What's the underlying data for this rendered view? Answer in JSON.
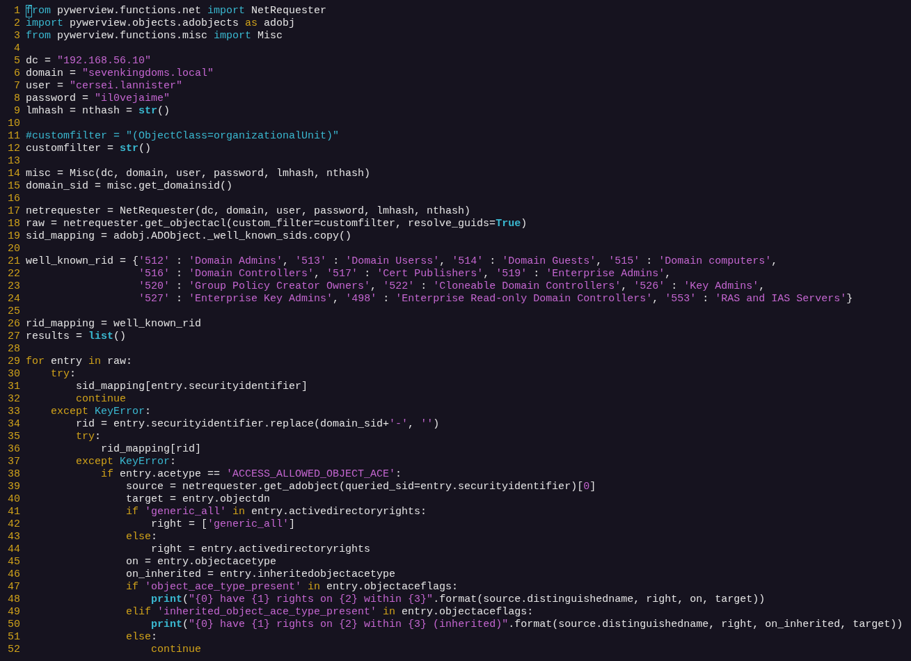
{
  "editor": {
    "lines": [
      {
        "number": "1",
        "cursor": true,
        "tokens": [
          {
            "kind": "import",
            "text": "from"
          },
          {
            "kind": "text",
            "text": " pywerview.functions.net "
          },
          {
            "kind": "import",
            "text": "import"
          },
          {
            "kind": "text",
            "text": " NetRequester"
          }
        ]
      },
      {
        "number": "2",
        "cursor": false,
        "tokens": [
          {
            "kind": "import",
            "text": "import"
          },
          {
            "kind": "text",
            "text": " pywerview.objects.adobjects "
          },
          {
            "kind": "keyword",
            "text": "as"
          },
          {
            "kind": "text",
            "text": " adobj"
          }
        ]
      },
      {
        "number": "3",
        "cursor": false,
        "tokens": [
          {
            "kind": "import",
            "text": "from"
          },
          {
            "kind": "text",
            "text": " pywerview.functions.misc "
          },
          {
            "kind": "import",
            "text": "import"
          },
          {
            "kind": "text",
            "text": " Misc"
          }
        ]
      },
      {
        "number": "4",
        "cursor": false
      },
      {
        "number": "5",
        "cursor": false,
        "tokens": [
          {
            "kind": "text",
            "text": "dc = "
          },
          {
            "kind": "string",
            "text": "\"192.168.56.10\""
          }
        ]
      },
      {
        "number": "6",
        "cursor": false,
        "tokens": [
          {
            "kind": "text",
            "text": "domain = "
          },
          {
            "kind": "string",
            "text": "\"sevenkingdoms.local\""
          }
        ]
      },
      {
        "number": "7",
        "cursor": false,
        "tokens": [
          {
            "kind": "text",
            "text": "user = "
          },
          {
            "kind": "string",
            "text": "\"cersei.lannister\""
          }
        ]
      },
      {
        "number": "8",
        "cursor": false,
        "tokens": [
          {
            "kind": "text",
            "text": "password = "
          },
          {
            "kind": "string",
            "text": "\"il0vejaime\""
          }
        ]
      },
      {
        "number": "9",
        "cursor": false,
        "tokens": [
          {
            "kind": "text",
            "text": "lmhash = nthash = "
          },
          {
            "kind": "builtin",
            "text": "str"
          },
          {
            "kind": "text",
            "text": "()"
          }
        ]
      },
      {
        "number": "10",
        "cursor": false
      },
      {
        "number": "11",
        "cursor": false,
        "tokens": [
          {
            "kind": "comment",
            "text": "#customfilter = \"(ObjectClass=organizationalUnit)\""
          }
        ]
      },
      {
        "number": "12",
        "cursor": false,
        "tokens": [
          {
            "kind": "text",
            "text": "customfilter = "
          },
          {
            "kind": "builtin",
            "text": "str"
          },
          {
            "kind": "text",
            "text": "()"
          }
        ]
      },
      {
        "number": "13",
        "cursor": false
      },
      {
        "number": "14",
        "cursor": false,
        "tokens": [
          {
            "kind": "text",
            "text": "misc = Misc(dc, domain, user, password, lmhash, nthash)"
          }
        ]
      },
      {
        "number": "15",
        "cursor": false,
        "tokens": [
          {
            "kind": "text",
            "text": "domain_sid = misc.get_domainsid()"
          }
        ]
      },
      {
        "number": "16",
        "cursor": false
      },
      {
        "number": "17",
        "cursor": false,
        "tokens": [
          {
            "kind": "text",
            "text": "netrequester = NetRequester(dc, domain, user, password, lmhash, nthash)"
          }
        ]
      },
      {
        "number": "18",
        "cursor": false,
        "tokens": [
          {
            "kind": "text",
            "text": "raw = netrequester.get_objectacl(custom_filter=customfilter, resolve_guids="
          },
          {
            "kind": "builtin",
            "text": "True"
          },
          {
            "kind": "text",
            "text": ")"
          }
        ]
      },
      {
        "number": "19",
        "cursor": false,
        "tokens": [
          {
            "kind": "text",
            "text": "sid_mapping = adobj.ADObject._well_known_sids.copy()"
          }
        ]
      },
      {
        "number": "20",
        "cursor": false
      },
      {
        "number": "21",
        "cursor": false,
        "tokens": [
          {
            "kind": "text",
            "text": "well_known_rid = {"
          },
          {
            "kind": "string",
            "text": "'512'"
          },
          {
            "kind": "text",
            "text": " : "
          },
          {
            "kind": "string",
            "text": "'Domain Admins'"
          },
          {
            "kind": "text",
            "text": ", "
          },
          {
            "kind": "string",
            "text": "'513'"
          },
          {
            "kind": "text",
            "text": " : "
          },
          {
            "kind": "string",
            "text": "'Domain Userss'"
          },
          {
            "kind": "text",
            "text": ", "
          },
          {
            "kind": "string",
            "text": "'514'"
          },
          {
            "kind": "text",
            "text": " : "
          },
          {
            "kind": "string",
            "text": "'Domain Guests'"
          },
          {
            "kind": "text",
            "text": ", "
          },
          {
            "kind": "string",
            "text": "'515'"
          },
          {
            "kind": "text",
            "text": " : "
          },
          {
            "kind": "string",
            "text": "'Domain computers'"
          },
          {
            "kind": "text",
            "text": ","
          }
        ]
      },
      {
        "number": "22",
        "cursor": false,
        "tokens": [
          {
            "kind": "string",
            "text": "                  '516'"
          },
          {
            "kind": "text",
            "text": " : "
          },
          {
            "kind": "string",
            "text": "'Domain Controllers'"
          },
          {
            "kind": "text",
            "text": ", "
          },
          {
            "kind": "string",
            "text": "'517'"
          },
          {
            "kind": "text",
            "text": " : "
          },
          {
            "kind": "string",
            "text": "'Cert Publishers'"
          },
          {
            "kind": "text",
            "text": ", "
          },
          {
            "kind": "string",
            "text": "'519'"
          },
          {
            "kind": "text",
            "text": " : "
          },
          {
            "kind": "string",
            "text": "'Enterprise Admins'"
          },
          {
            "kind": "text",
            "text": ","
          }
        ]
      },
      {
        "number": "23",
        "cursor": false,
        "tokens": [
          {
            "kind": "string",
            "text": "                  '520'"
          },
          {
            "kind": "text",
            "text": " : "
          },
          {
            "kind": "string",
            "text": "'Group Policy Creator Owners'"
          },
          {
            "kind": "text",
            "text": ", "
          },
          {
            "kind": "string",
            "text": "'522'"
          },
          {
            "kind": "text",
            "text": " : "
          },
          {
            "kind": "string",
            "text": "'Cloneable Domain Controllers'"
          },
          {
            "kind": "text",
            "text": ", "
          },
          {
            "kind": "string",
            "text": "'526'"
          },
          {
            "kind": "text",
            "text": " : "
          },
          {
            "kind": "string",
            "text": "'Key Admins'"
          },
          {
            "kind": "text",
            "text": ","
          }
        ]
      },
      {
        "number": "24",
        "cursor": false,
        "tokens": [
          {
            "kind": "string",
            "text": "                  '527'"
          },
          {
            "kind": "text",
            "text": " : "
          },
          {
            "kind": "string",
            "text": "'Enterprise Key Admins'"
          },
          {
            "kind": "text",
            "text": ", "
          },
          {
            "kind": "string",
            "text": "'498'"
          },
          {
            "kind": "text",
            "text": " : "
          },
          {
            "kind": "string",
            "text": "'Enterprise Read-only Domain Controllers'"
          },
          {
            "kind": "text",
            "text": ", "
          },
          {
            "kind": "string",
            "text": "'553'"
          },
          {
            "kind": "text",
            "text": " : "
          },
          {
            "kind": "string",
            "text": "'RAS and IAS Servers'"
          },
          {
            "kind": "text",
            "text": "}"
          }
        ]
      },
      {
        "number": "25",
        "cursor": false
      },
      {
        "number": "26",
        "cursor": false,
        "tokens": [
          {
            "kind": "text",
            "text": "rid_mapping = well_known_rid"
          }
        ]
      },
      {
        "number": "27",
        "cursor": false,
        "tokens": [
          {
            "kind": "text",
            "text": "results = "
          },
          {
            "kind": "builtin",
            "text": "list"
          },
          {
            "kind": "text",
            "text": "()"
          }
        ]
      },
      {
        "number": "28",
        "cursor": false
      },
      {
        "number": "29",
        "cursor": false,
        "tokens": [
          {
            "kind": "keyword",
            "text": "for"
          },
          {
            "kind": "text",
            "text": " entry "
          },
          {
            "kind": "keyword",
            "text": "in"
          },
          {
            "kind": "text",
            "text": " raw:"
          }
        ]
      },
      {
        "number": "30",
        "cursor": false,
        "tokens": [
          {
            "kind": "keyword",
            "text": "    try"
          },
          {
            "kind": "text",
            "text": ":"
          }
        ]
      },
      {
        "number": "31",
        "cursor": false,
        "tokens": [
          {
            "kind": "text",
            "text": "        sid_mapping[entry.securityidentifier]"
          }
        ]
      },
      {
        "number": "32",
        "cursor": false,
        "tokens": [
          {
            "kind": "keyword",
            "text": "        continue"
          }
        ]
      },
      {
        "number": "33",
        "cursor": false,
        "tokens": [
          {
            "kind": "keyword",
            "text": "    except"
          },
          {
            "kind": "exception",
            "text": " KeyError"
          },
          {
            "kind": "text",
            "text": ":"
          }
        ]
      },
      {
        "number": "34",
        "cursor": false,
        "tokens": [
          {
            "kind": "text",
            "text": "        rid = entry.securityidentifier.replace(domain_sid+"
          },
          {
            "kind": "string",
            "text": "'-'"
          },
          {
            "kind": "text",
            "text": ", "
          },
          {
            "kind": "string",
            "text": "''"
          },
          {
            "kind": "text",
            "text": ")"
          }
        ]
      },
      {
        "number": "35",
        "cursor": false,
        "tokens": [
          {
            "kind": "keyword",
            "text": "        try"
          },
          {
            "kind": "text",
            "text": ":"
          }
        ]
      },
      {
        "number": "36",
        "cursor": false,
        "tokens": [
          {
            "kind": "text",
            "text": "            rid_mapping[rid]"
          }
        ]
      },
      {
        "number": "37",
        "cursor": false,
        "tokens": [
          {
            "kind": "keyword",
            "text": "        except"
          },
          {
            "kind": "exception",
            "text": " KeyError"
          },
          {
            "kind": "text",
            "text": ":"
          }
        ]
      },
      {
        "number": "38",
        "cursor": false,
        "tokens": [
          {
            "kind": "keyword",
            "text": "            if"
          },
          {
            "kind": "text",
            "text": " entry.acetype == "
          },
          {
            "kind": "string",
            "text": "'ACCESS_ALLOWED_OBJECT_ACE'"
          },
          {
            "kind": "text",
            "text": ":"
          }
        ]
      },
      {
        "number": "39",
        "cursor": false,
        "tokens": [
          {
            "kind": "text",
            "text": "                source = netrequester.get_adobject(queried_sid=entry.securityidentifier)["
          },
          {
            "kind": "number",
            "text": "0"
          },
          {
            "kind": "text",
            "text": "]"
          }
        ]
      },
      {
        "number": "40",
        "cursor": false,
        "tokens": [
          {
            "kind": "text",
            "text": "                target = entry.objectdn"
          }
        ]
      },
      {
        "number": "41",
        "cursor": false,
        "tokens": [
          {
            "kind": "keyword",
            "text": "                if"
          },
          {
            "kind": "string",
            "text": " 'generic_all'"
          },
          {
            "kind": "keyword",
            "text": " in"
          },
          {
            "kind": "text",
            "text": " entry.activedirectoryrights:"
          }
        ]
      },
      {
        "number": "42",
        "cursor": false,
        "tokens": [
          {
            "kind": "text",
            "text": "                    right = ["
          },
          {
            "kind": "string",
            "text": "'generic_all'"
          },
          {
            "kind": "text",
            "text": "]"
          }
        ]
      },
      {
        "number": "43",
        "cursor": false,
        "tokens": [
          {
            "kind": "keyword",
            "text": "                else"
          },
          {
            "kind": "text",
            "text": ":"
          }
        ]
      },
      {
        "number": "44",
        "cursor": false,
        "tokens": [
          {
            "kind": "text",
            "text": "                    right = entry.activedirectoryrights"
          }
        ]
      },
      {
        "number": "45",
        "cursor": false,
        "tokens": [
          {
            "kind": "text",
            "text": "                on = entry.objectacetype"
          }
        ]
      },
      {
        "number": "46",
        "cursor": false,
        "tokens": [
          {
            "kind": "text",
            "text": "                on_inherited = entry.inheritedobjectacetype"
          }
        ]
      },
      {
        "number": "47",
        "cursor": false,
        "tokens": [
          {
            "kind": "keyword",
            "text": "                if"
          },
          {
            "kind": "string",
            "text": " 'object_ace_type_present'"
          },
          {
            "kind": "keyword",
            "text": " in"
          },
          {
            "kind": "text",
            "text": " entry.objectaceflags:"
          }
        ]
      },
      {
        "number": "48",
        "cursor": false,
        "tokens": [
          {
            "kind": "builtin",
            "text": "                    print"
          },
          {
            "kind": "text",
            "text": "("
          },
          {
            "kind": "string",
            "text": "\"{0} have {1} rights on {2} within {3}\""
          },
          {
            "kind": "text",
            "text": ".format(source.distinguishedname, right, on, target))"
          }
        ]
      },
      {
        "number": "49",
        "cursor": false,
        "tokens": [
          {
            "kind": "keyword",
            "text": "                elif"
          },
          {
            "kind": "string",
            "text": " 'inherited_object_ace_type_present'"
          },
          {
            "kind": "keyword",
            "text": " in"
          },
          {
            "kind": "text",
            "text": " entry.objectaceflags:"
          }
        ]
      },
      {
        "number": "50",
        "cursor": false,
        "tokens": [
          {
            "kind": "builtin",
            "text": "                    print"
          },
          {
            "kind": "text",
            "text": "("
          },
          {
            "kind": "string",
            "text": "\"{0} have {1} rights on {2} within {3} (inherited)\""
          },
          {
            "kind": "text",
            "text": ".format(source.distinguishedname, right, on_inherited, target))"
          }
        ]
      },
      {
        "number": "51",
        "cursor": false,
        "tokens": [
          {
            "kind": "keyword",
            "text": "                else"
          },
          {
            "kind": "text",
            "text": ":"
          }
        ]
      },
      {
        "number": "52",
        "cursor": false,
        "tokens": [
          {
            "kind": "keyword",
            "text": "                    continue"
          }
        ]
      }
    ]
  }
}
